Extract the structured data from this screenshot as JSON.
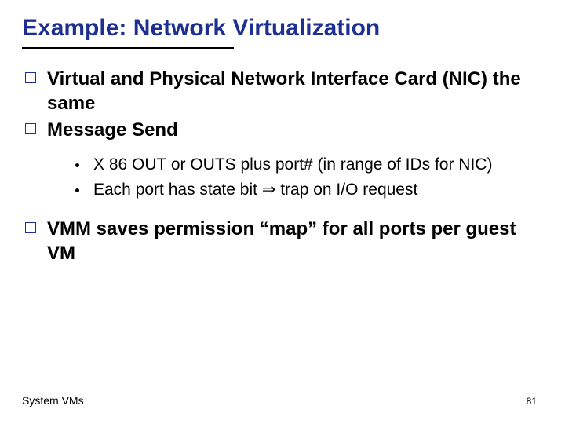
{
  "title": "Example: Network Virtualization",
  "bullets": {
    "b1": "Virtual and Physical Network Interface Card (NIC) the same",
    "b2": "Message Send",
    "b2_sub1": "X 86 OUT or OUTS plus port# (in range of IDs for NIC)",
    "b2_sub2": "Each port has state bit ⇒ trap on I/O request",
    "b3": "VMM saves permission “map” for all ports per guest VM"
  },
  "footer": {
    "left": "System VMs",
    "page": "81"
  }
}
